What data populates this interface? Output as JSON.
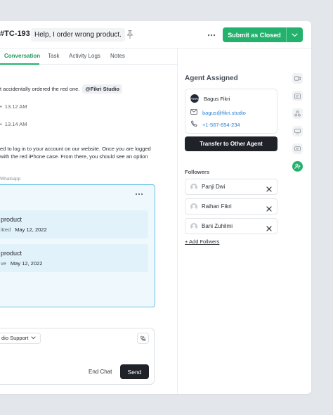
{
  "header": {
    "ticket_id": "#TC-193",
    "ticket_title": "Help, I order wrong product.",
    "submit_label": "Submit as Closed"
  },
  "tabs": [
    {
      "label": "Conversation",
      "active": true
    },
    {
      "label": "Task",
      "active": false
    },
    {
      "label": "Activity Logs",
      "active": false
    },
    {
      "label": "Notes",
      "active": false
    }
  ],
  "conversation": {
    "msg1_text": "t accidentally ordered the red one.",
    "msg1_mention": "@Fikri Studio",
    "time1": "13.12 AM",
    "time2": "13.14 AM",
    "reply_line1": "ed to log in to your account on our website. Once you are logged",
    "reply_line2": "with the red iPhone case. From there, you should see an option",
    "channel_label": "Whatsapp",
    "orders": [
      {
        "name": "product",
        "meta_label": "itted",
        "date": "May 12, 2022"
      },
      {
        "name": "product",
        "meta_label": "ve",
        "date": "May 12, 2022"
      }
    ]
  },
  "composer": {
    "channel_value": "dio Support",
    "end_chat_label": "End Chat",
    "send_label": "Send"
  },
  "agent": {
    "section_title": "Agent Assigned",
    "avatar_initials": "FIKRI",
    "name": "Bagus Fikri",
    "email": "bagus@fikri.studio",
    "phone": "+1-567-654-234",
    "transfer_label": "Transfer to Other Agent"
  },
  "followers": {
    "title": "Followers",
    "items": [
      {
        "name": "Panji Dwi"
      },
      {
        "name": "Raihan Fikri"
      },
      {
        "name": "Bani Zuhilmi"
      }
    ],
    "add_label": "+ Add Follwers"
  },
  "colors": {
    "accent": "#23b26d",
    "dark": "#1f2329",
    "link": "#2b7fd1",
    "order_border": "#6cc2e5"
  },
  "icons": {
    "pin": "pin-icon",
    "more": "more-horizontal-icon",
    "caret": "chevron-down-icon",
    "mail": "mail-icon",
    "phone": "phone-icon",
    "call": "phone-call-icon",
    "close": "close-icon",
    "rail": [
      "video-icon",
      "document-icon",
      "integration-icon",
      "monitor-icon",
      "chat-icon",
      "user-add-icon"
    ]
  }
}
